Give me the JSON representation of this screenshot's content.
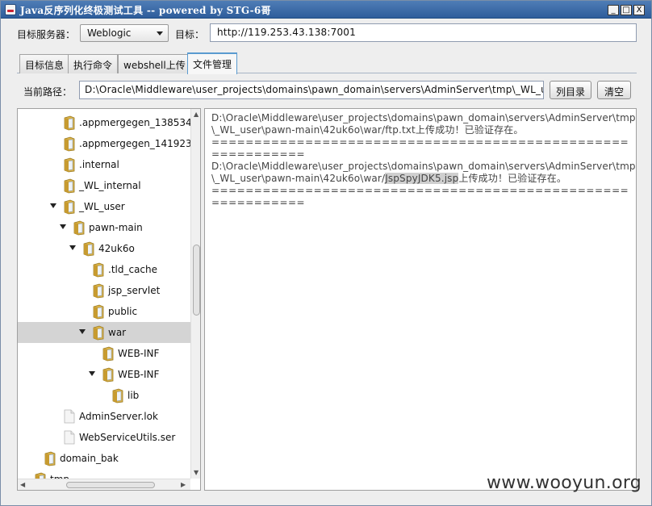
{
  "window": {
    "title": "Java反序列化终极测试工具  -- powered by STG-6哥",
    "controls": [
      "_",
      "□",
      "X"
    ]
  },
  "target": {
    "server_label": "目标服务器：",
    "server_value": "Weblogic",
    "target_label": "目标：",
    "target_value": "http://119.253.43.138:7001"
  },
  "tabs": [
    {
      "label": "目标信息",
      "active": false
    },
    {
      "label": "执行命令",
      "active": false
    },
    {
      "label": "webshell上传",
      "active": false
    },
    {
      "label": "文件管理",
      "active": true
    }
  ],
  "path_bar": {
    "label": "当前路径：",
    "value": "D:\\Oracle\\Middleware\\user_projects\\domains\\pawn_domain\\servers\\AdminServer\\tmp\\_WL_us",
    "list_button": "列目录",
    "clear_button": "清空"
  },
  "tree": {
    "nodes": [
      {
        "label": ".appmergegen_138534",
        "type": "folder",
        "level": 3,
        "expanded": false,
        "selected": false
      },
      {
        "label": ".appmergegen_141923",
        "type": "folder",
        "level": 3,
        "expanded": false,
        "selected": false
      },
      {
        "label": ".internal",
        "type": "folder",
        "level": 3,
        "expanded": false,
        "selected": false
      },
      {
        "label": "_WL_internal",
        "type": "folder",
        "level": 3,
        "expanded": false,
        "selected": false
      },
      {
        "label": "_WL_user",
        "type": "folder",
        "level": 3,
        "expanded": true,
        "selected": false
      },
      {
        "label": "pawn-main",
        "type": "folder",
        "level": 4,
        "expanded": true,
        "selected": false
      },
      {
        "label": "42uk6o",
        "type": "folder",
        "level": 5,
        "expanded": true,
        "selected": false
      },
      {
        "label": ".tld_cache",
        "type": "folder",
        "level": 6,
        "expanded": false,
        "selected": false
      },
      {
        "label": "jsp_servlet",
        "type": "folder",
        "level": 6,
        "expanded": false,
        "selected": false
      },
      {
        "label": "public",
        "type": "folder",
        "level": 6,
        "expanded": false,
        "selected": false
      },
      {
        "label": "war",
        "type": "folder",
        "level": 6,
        "expanded": true,
        "selected": true
      },
      {
        "label": "WEB-INF",
        "type": "folder",
        "level": 7,
        "expanded": false,
        "selected": false
      },
      {
        "label": "WEB-INF",
        "type": "folder",
        "level": 7,
        "expanded": true,
        "selected": false
      },
      {
        "label": "lib",
        "type": "folder",
        "level": 8,
        "expanded": false,
        "selected": false
      },
      {
        "label": "AdminServer.lok",
        "type": "file",
        "level": 3,
        "expanded": false,
        "selected": false
      },
      {
        "label": "WebServiceUtils.ser",
        "type": "file",
        "level": 3,
        "expanded": false,
        "selected": false
      },
      {
        "label": "domain_bak",
        "type": "folder",
        "level": 1,
        "expanded": false,
        "selected": false
      },
      {
        "label": "tmp",
        "type": "folder",
        "level": 0,
        "expanded": false,
        "selected": false
      }
    ]
  },
  "output": {
    "entry1_line1": "D:\\Oracle\\Middleware\\user_projects\\domains\\pawn_domain\\servers\\AdminServer\\tmp",
    "entry1_line2": "\\_WL_user\\pawn-main\\42uk6o\\war/ftp.txt上传成功！已验证存在。",
    "separator": "========================================================",
    "separator_tail": "===========",
    "entry2_line1": "D:\\Oracle\\Middleware\\user_projects\\domains\\pawn_domain\\servers\\AdminServer\\tmp",
    "entry2_prefix": "\\_WL_user\\pawn-main\\42uk6o\\war/",
    "entry2_file": "JspSpyJDK5.jsp",
    "entry2_suffix": "上传成功！已验证存在。"
  },
  "watermark": "www.wooyun.org",
  "colors": {
    "titlebar": "#2e5d9b",
    "folder": "#d9b24a",
    "selected_row": "#d4d4d4",
    "active_tab_border": "#5a9bd0"
  }
}
